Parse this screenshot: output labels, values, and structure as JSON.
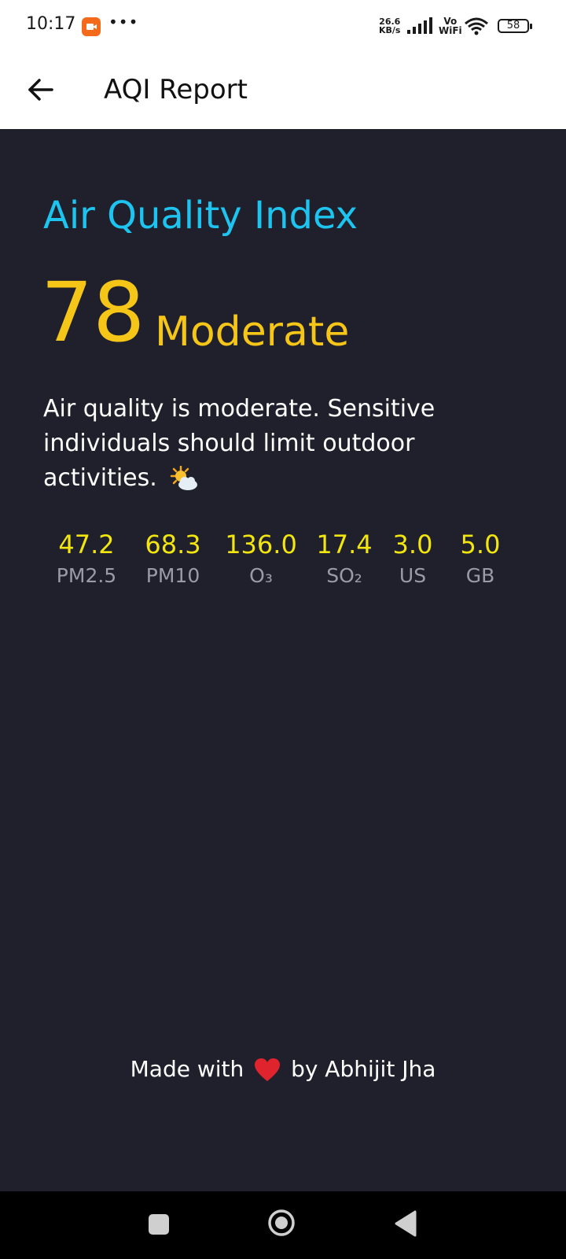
{
  "status_bar": {
    "time": "10:17",
    "speed_value": "26.6",
    "speed_unit": "KB/s",
    "vo": "Vo",
    "wifi_label": "WiFi",
    "battery": "58"
  },
  "app_bar": {
    "title": "AQI Report",
    "back_icon": "arrow-left-icon"
  },
  "aqi": {
    "heading": "Air Quality Index",
    "value": "78",
    "category": "Moderate",
    "description": "Air quality is moderate. Sensitive individuals should limit outdoor activities.",
    "description_icon": "sun-behind-cloud-icon"
  },
  "pollutants": [
    {
      "value": "47.2",
      "name": "PM2.5"
    },
    {
      "value": "68.3",
      "name": "PM10"
    },
    {
      "value": "136.0",
      "name": "O₃"
    },
    {
      "value": "17.4",
      "name": "SO₂"
    },
    {
      "value": "3.0",
      "name": "US"
    },
    {
      "value": "5.0",
      "name": "GB"
    }
  ],
  "footer": {
    "prefix": "Made with",
    "suffix": "by Abhijit Jha",
    "icon": "heart-icon"
  },
  "colors": {
    "background": "#1f202c",
    "heading": "#1dc4f0",
    "aqi_value": "#f5c518",
    "pollutant_value": "#f2e60e",
    "pollutant_label": "#9a9ba6"
  },
  "nav_bar": {
    "recents_icon": "square-icon",
    "home_icon": "circle-icon",
    "back_icon": "triangle-back-icon"
  }
}
